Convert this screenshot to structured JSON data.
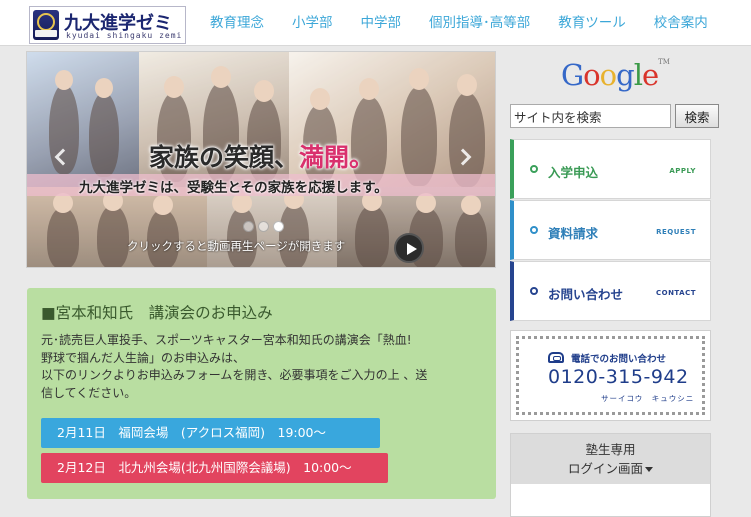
{
  "header": {
    "logo_title": "九大進学ゼミ",
    "logo_subtitle": "kyudai shingaku zemi",
    "nav": [
      "教育理念",
      "小学部",
      "中学部",
      "個別指導･高等部",
      "教育ツール",
      "校舎案内"
    ]
  },
  "slider": {
    "headline_main": "家族の笑顔、",
    "headline_accent": "満開。",
    "subline": "九大進学ゼミは、受験生とその家族を応援します。",
    "caption": "クリックすると動画再生ページが開きます",
    "slide_count": 3,
    "active_slide": 3
  },
  "lecture": {
    "title": "■宮本和知氏　講演会のお申込み",
    "body_lines": [
      "元･読売巨人軍投手、スポーツキャスター宮本和知氏の講演会「熱血!",
      "野球で掴んだ人生論」のお申込みは、",
      "以下のリンクよりお申込みフォームを開き、必要事項をご入力の上 、送",
      "信してください。"
    ],
    "button_1": "2月11日　福岡会場　(アクロス福岡)　19:00～",
    "button_2": "2月12日　北九州会場(北九州国際会議場)　10:00～"
  },
  "search": {
    "brand": "Google",
    "brand_tm": "TM",
    "value": "サイト内を検索",
    "button": "検索"
  },
  "side_menu": [
    {
      "jp": "入学申込",
      "en": "APPLY"
    },
    {
      "jp": "資料請求",
      "en": "REQUEST"
    },
    {
      "jp": "お問い合わせ",
      "en": "CONTACT"
    }
  ],
  "phone": {
    "label": "電話でのお問い合わせ",
    "number": "0120-315-942",
    "kana": "サーイコウ　キュウシニ"
  },
  "login": {
    "line_1": "塾生専用",
    "line_2": "ログイン画面"
  },
  "colors": {
    "nav_text": "#3ca7d8",
    "lecture_bg": "#b9dea1",
    "button_blue": "#39a7dd",
    "button_red": "#e2445f",
    "apply": "#3aa05a",
    "request": "#2f8fc9",
    "contact": "#26448f"
  },
  "icons": [
    "school-crest-icon",
    "arrow-left-icon",
    "arrow-right-icon",
    "play-icon",
    "phone-icon",
    "caret-down-icon"
  ]
}
